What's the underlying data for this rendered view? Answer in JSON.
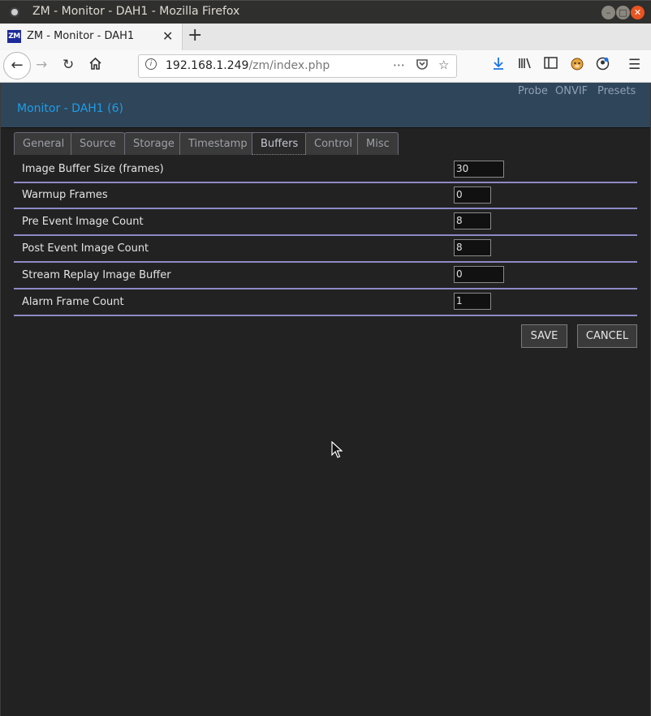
{
  "window": {
    "title": "ZM - Monitor - DAH1 - Mozilla Firefox",
    "min": "–",
    "max": "□",
    "close": "✕"
  },
  "browser": {
    "tab_title": "ZM - Monitor - DAH1",
    "tab_favicon": "ZM",
    "tab_close": "✕",
    "new_tab": "+",
    "url_host": "192.168.1.249",
    "url_path": "/zm/index.php"
  },
  "page": {
    "heading": "Monitor - DAH1 (6)",
    "header_links": [
      "Probe",
      "ONVIF",
      "Presets"
    ],
    "tabs": [
      "General",
      "Source",
      "Storage",
      "Timestamp",
      "Buffers",
      "Control",
      "Misc"
    ],
    "active_tab": "Buffers",
    "fields": [
      {
        "label": "Image Buffer Size (frames)",
        "value": "30"
      },
      {
        "label": "Warmup Frames",
        "value": "0"
      },
      {
        "label": "Pre Event Image Count",
        "value": "8"
      },
      {
        "label": "Post Event Image Count",
        "value": "8"
      },
      {
        "label": "Stream Replay Image Buffer",
        "value": "0"
      },
      {
        "label": "Alarm Frame Count",
        "value": "1"
      }
    ],
    "save_label": "SAVE",
    "cancel_label": "CANCEL"
  },
  "colors": {
    "header_bg": "#2f4559",
    "heading_text": "#1e9ee8",
    "row_divider": "#8d89c6",
    "page_bg": "#222222"
  }
}
